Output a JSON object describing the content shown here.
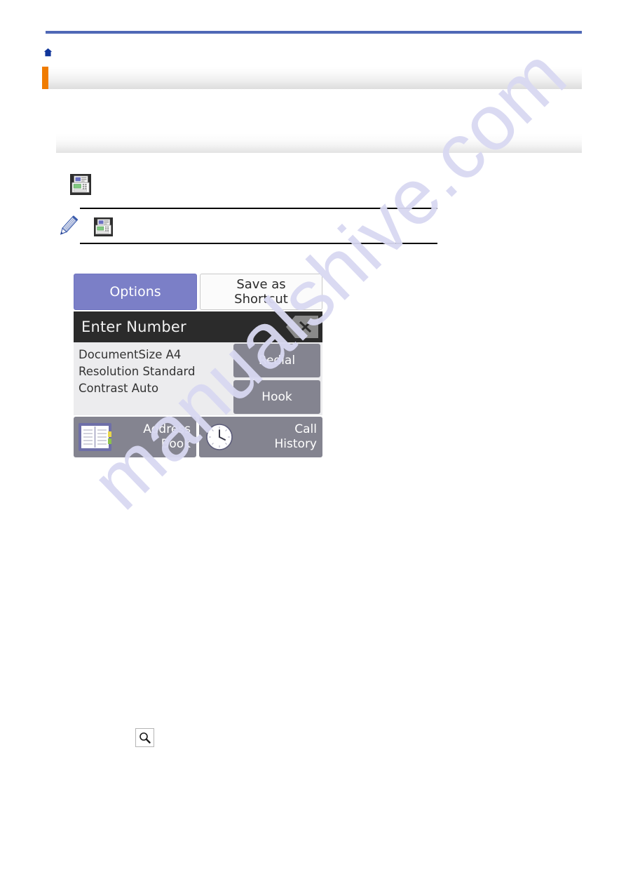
{
  "document": {
    "breadcrumb": "",
    "heading": "",
    "subheading": "",
    "step_text": "",
    "note_text": "",
    "search_text": ""
  },
  "icons": {
    "home": "home-icon",
    "fax_machine": "fax-machine-icon",
    "pencil": "pencil-icon",
    "search": "search-icon",
    "backspace": "backspace-icon",
    "address_book": "address-book-icon",
    "clock": "clock-icon"
  },
  "lcd": {
    "options_label": "Options",
    "shortcut_label_line1": "Save as",
    "shortcut_label_line2": "Shortcut",
    "number_placeholder": "Enter Number",
    "settings": [
      "DocumentSize A4",
      "Resolution Standard",
      "Contrast Auto"
    ],
    "redial_label": "Redial",
    "hook_label": "Hook",
    "address_book_line1": "Address",
    "address_book_line2": "Book",
    "call_history_line1": "Call",
    "call_history_line2": "History"
  },
  "watermark": {
    "text": "manualshive.com"
  },
  "colors": {
    "rule_blue": "#4f68b6",
    "accent_orange": "#f07c00",
    "home_blue": "#10359a",
    "lcd_options": "#7b7fc7",
    "lcd_button_gray": "#848490",
    "lcd_dark_bar": "#2b2b2b",
    "watermark": "#d9d9f2"
  }
}
